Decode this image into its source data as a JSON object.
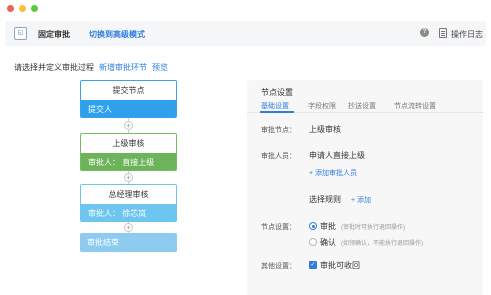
{
  "toolbar": {
    "app_icon": "window-icon",
    "title": "固定审批",
    "switch_link": "切换到高级模式",
    "help_icon_glyph": "?",
    "log_label": "操作日志"
  },
  "hint": {
    "text": "请选择并定义审批过程",
    "add_link": "新增审批环节",
    "preview_link": "预览"
  },
  "flow": {
    "nodes": [
      {
        "header": "提交节点",
        "body": "提交人"
      },
      {
        "header": "上级审核",
        "body": "审批人：  直接上级"
      },
      {
        "header": "总经理审核",
        "body": "审批人：  徐芯岚"
      }
    ],
    "end": "审批结束",
    "add_glyph": "+"
  },
  "panel": {
    "title": "节点设置",
    "tabs": [
      "基础设置",
      "字段权限",
      "抄送设置",
      "节点流转设置"
    ],
    "active_tab": 0,
    "node_label": "审批节点：",
    "node_value": "上级审核",
    "approver_label": "审批人员：",
    "approver_value": "申请人直接上级",
    "add_approver": "+ 添加审批人员",
    "rule_label": "选择规则",
    "rule_add": "+ 添加",
    "node_setting_label": "节点设置：",
    "options": [
      {
        "label": "审批",
        "note": "(审批时可执行退回操作)",
        "selected": true
      },
      {
        "label": "确认",
        "note": "(如领确认，不能执行退回操作)",
        "selected": false
      }
    ],
    "other_label": "其他设置：",
    "recall_label": "审批可收回",
    "recall_checked": true,
    "check_glyph": "✓"
  },
  "colors": {
    "accent": "#2f7de1",
    "node_submit": "#2ea0ec",
    "node_supervisor": "#6cb35a",
    "node_manager": "#6cc6ef",
    "node_end": "#8dcbef"
  }
}
